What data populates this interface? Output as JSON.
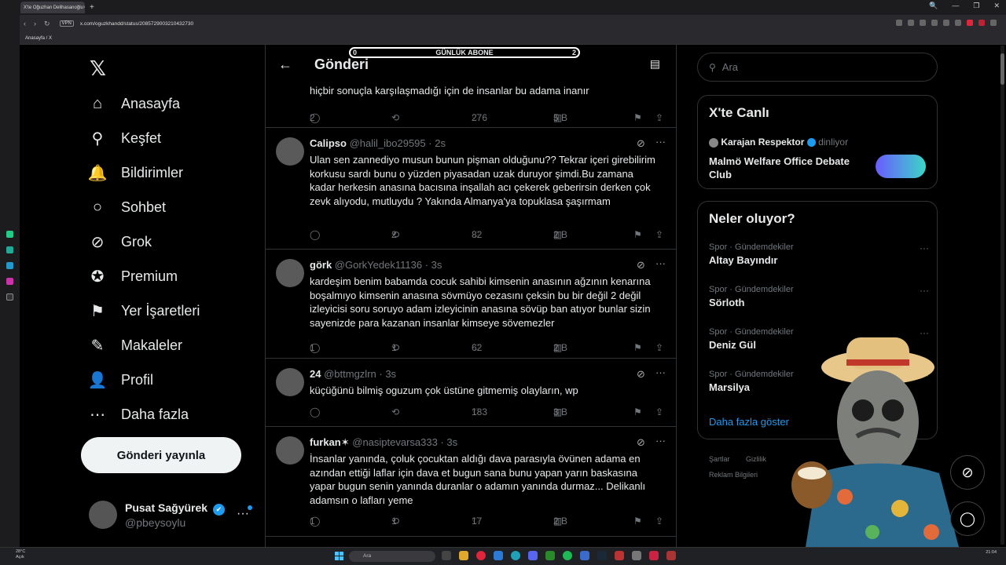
{
  "browser": {
    "tab_title": "X'te Oğuzhan Delihasanoğlu",
    "tab_close": "×",
    "new_tab": "+",
    "url": "x.com/oguzkhandd/status/2085729003210432730",
    "vpn": "VPN",
    "bookmark": "Anasayfa / X",
    "window_controls": [
      "🔍",
      "—",
      "❐",
      "✕"
    ]
  },
  "nav": {
    "logo": "𝕏",
    "items": [
      {
        "label": "Anasayfa",
        "icon": "home-icon",
        "glyph": "⌂"
      },
      {
        "label": "Keşfet",
        "icon": "search-icon",
        "glyph": "⚲"
      },
      {
        "label": "Bildirimler",
        "icon": "bell-icon",
        "glyph": "🔔"
      },
      {
        "label": "Sohbet",
        "icon": "chat-icon",
        "glyph": "○"
      },
      {
        "label": "Grok",
        "icon": "grok-icon",
        "glyph": "⊘"
      },
      {
        "label": "Premium",
        "icon": "premium-icon",
        "glyph": "✪"
      },
      {
        "label": "Yer İşaretleri",
        "icon": "bookmark-icon",
        "glyph": "⚑"
      },
      {
        "label": "Makaleler",
        "icon": "article-icon",
        "glyph": "✎"
      },
      {
        "label": "Profil",
        "icon": "profile-icon",
        "glyph": "👤"
      },
      {
        "label": "Daha fazla",
        "icon": "more-icon",
        "glyph": "⋯"
      }
    ],
    "post_button": "Gönderi yayınla",
    "account": {
      "name": "Pusat Sağyürek",
      "handle": "@pbeysoylu",
      "verified": "✔",
      "more": "···"
    }
  },
  "header": {
    "back": "←",
    "title": "Gönderi",
    "reader": "▤"
  },
  "overlay": {
    "label": "GÜNLÜK ABONE",
    "left_value": "0",
    "right_value": "2"
  },
  "tweets": [
    {
      "text": "hiçbir sonuçla karşılaşmadığı için de insanlar bu adama inanır",
      "replies": "2",
      "reposts": "",
      "likes": "276",
      "views": "5 B"
    },
    {
      "name": "Calipso",
      "handle": "@halil_ibo29595",
      "time": "· 2s",
      "text": "Ulan sen zannediyo musun bunun pişman olduğunu?? Tekrar içeri girebilirim korkusu sardı bunu o yüzden piyasadan uzak duruyor şimdi.Bu zamana kadar herkesin anasına bacısına inşallah acı çekerek geberirsin derken çok zevk alıyodu, mutluydu ? Yakında Almanya'ya topuklasa şaşırmam",
      "replies": "",
      "reposts": "2",
      "likes": "82",
      "views": "2 B"
    },
    {
      "name": "görk",
      "handle": "@GorkYedek11136",
      "time": "· 3s",
      "text": "kardeşim benim babamda cocuk sahibi kimsenin anasının ağzının kenarına boşalmıyo kimsenin anasına sövmüyo cezasını çeksin bu bir değil 2 değil izleyicisi soru soruyo adam izleyicinin anasına sövüp ban atıyor bunlar sizin sayenizde para kazanan insanlar kimseye sövemezler",
      "replies": "1",
      "reposts": "1",
      "likes": "62",
      "views": "2 B"
    },
    {
      "name": "24",
      "handle": "@bttmgzlrn",
      "time": "· 3s",
      "text": "küçüğünü bilmiş oguzum çok üstüne gitmemiş olayların, wp",
      "replies": "",
      "reposts": "",
      "likes": "183",
      "views": "3 B"
    },
    {
      "name": "furkan✶",
      "handle": "@nasiptevarsa333",
      "time": "· 3s",
      "text": "İnsanlar yanında, çoluk çocuktan aldığı dava parasıyla övünen adama en azından ettiği laflar için dava et bugun sana bunu yapan yarın baskasına yapar bugun senin yanında duranlar o adamın yanında durmaz... Delikanlı adamsın o lafları yeme",
      "replies": "1",
      "reposts": "1",
      "likes": "17",
      "views": "2 B"
    }
  ],
  "icons": {
    "reply": "◯",
    "repost": "⟲",
    "like": "♡",
    "views": "▥",
    "bookmark": "⚑",
    "share": "⇪",
    "grok": "⊘",
    "dots": "···"
  },
  "right": {
    "search_placeholder": "Ara",
    "live": {
      "title": "X'te Canlı",
      "host": "Karajan Respektor",
      "host_status": "dinliyor",
      "space_title": "Malmö Welfare Office Debate Club"
    },
    "trends": {
      "title": "Neler oluyor?",
      "items": [
        {
          "category": "Spor · Gündemdekiler",
          "name": "Altay Bayındır"
        },
        {
          "category": "Spor · Gündemdekiler",
          "name": "Sörloth"
        },
        {
          "category": "Spor · Gündemdekiler",
          "name": "Deniz Gül"
        },
        {
          "category": "Spor · Gündemdekiler",
          "name": "Marsilya"
        }
      ],
      "more": "Daha fazla göster"
    },
    "footer": {
      "terms": "Şartlar",
      "privacy": "Gizlilik",
      "ads": "Reklam Bilgileri"
    }
  },
  "taskbar": {
    "weather_temp": "28°C",
    "weather_text": "Açık",
    "search": "Ara",
    "time": "21:04"
  }
}
